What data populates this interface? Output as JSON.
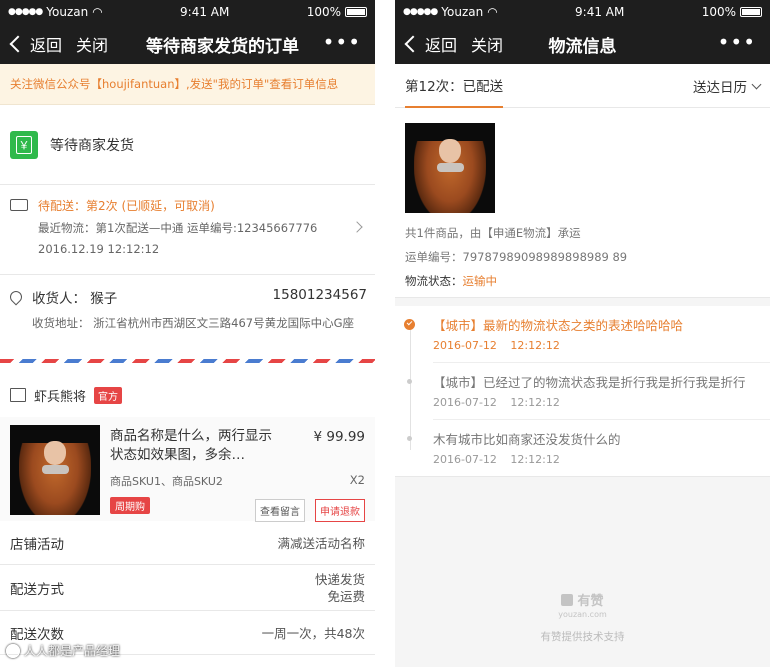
{
  "status_bar": {
    "carrier": "Youzan",
    "time": "9:41 AM",
    "battery": "100%"
  },
  "left": {
    "nav": {
      "back": "返回",
      "close": "关闭",
      "title": "等待商家发货的订单",
      "more": "•••"
    },
    "notice": "关注微信公众号【houjifantuan】,发送\"我的订单\"查看订单信息",
    "order_status": "等待商家发货",
    "money_glyph": "￥",
    "logistics": {
      "pending": "待配送：第2次 (已顺延，可取消)",
      "latest": "最近物流：第1次配送—中通 运单编号:12345667776",
      "time": "2016.12.19 12:12:12"
    },
    "address": {
      "receiver": "收货人：  猴子",
      "phone": "15801234567",
      "detail": "收货地址：  浙江省杭州市西湖区文三路467号黄龙国际中心G座"
    },
    "shop": {
      "name": "虾兵熊将",
      "badge": "官方"
    },
    "goods": {
      "name": "商品名称是什么，两行显示状态如效果图，多余…",
      "price": "¥ 99.99",
      "sku": "商品SKU1、商品SKU2",
      "qty": "X2",
      "tag": "周期购",
      "btn_message": "查看留言",
      "btn_refund": "申请退款"
    },
    "rows": [
      {
        "k": "店铺活动",
        "v": "满减送活动名称"
      },
      {
        "k": "配送方式",
        "v1": "快递发货",
        "v2": "免运费"
      },
      {
        "k": "配送次数",
        "v": "一周一次，共48次"
      }
    ],
    "watermark": "人人都是产品经理"
  },
  "right": {
    "nav": {
      "back": "返回",
      "close": "关闭",
      "title": "物流信息",
      "more": "•••"
    },
    "tab": "第12次：已配送",
    "calendar": "送达日历",
    "pkg": {
      "summary": "共1件商品，由【申通E物流】承运",
      "waybill": "运单编号：79787989098989898989 89",
      "status_label": "物流状态：",
      "status_value": "运输中"
    },
    "track": [
      {
        "text": "【城市】最新的物流状态之类的表述哈哈哈哈",
        "time": "2016-07-12 12:12:12"
      },
      {
        "text": "【城市】已经过了的物流状态我是折行我是折行我是折行",
        "time": "2016-07-12 12:12:12"
      },
      {
        "text": "木有城市比如商家还没发货什么的",
        "time": "2016-07-12 12:12:12"
      }
    ],
    "footer": {
      "brand": "有赞",
      "domain": "youzan.com",
      "support": "有赞提供技术支持"
    }
  },
  "colors": {
    "accent": "#e77f30",
    "red": "#e64545",
    "green": "#2fb94b",
    "nav_bg": "#1e1e1e"
  }
}
